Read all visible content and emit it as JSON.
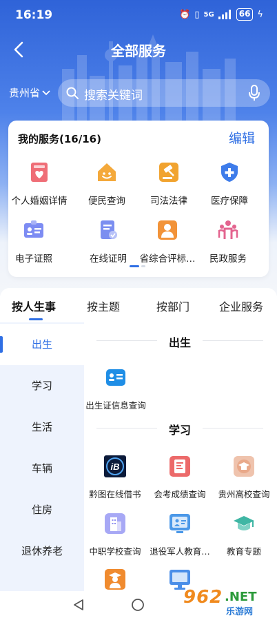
{
  "status_bar": {
    "time": "16:19",
    "network": "5G",
    "battery": "66"
  },
  "header": {
    "title": "全部服务"
  },
  "location": {
    "province": "贵州省"
  },
  "search": {
    "placeholder": "搜索关键词"
  },
  "my_services": {
    "title": "我的服务(16/16)",
    "edit_label": "编辑",
    "items": [
      {
        "label": "个人婚姻详情",
        "icon": "marriage-certificate-icon",
        "color": "#ef6e77"
      },
      {
        "label": "便民查询",
        "icon": "smile-house-icon",
        "color": "#f4a93b"
      },
      {
        "label": "司法法律",
        "icon": "gavel-icon",
        "color": "#f1a32f"
      },
      {
        "label": "医疗保障",
        "icon": "medical-shield-icon",
        "color": "#3e7cea"
      },
      {
        "label": "电子证照",
        "icon": "id-card-icon",
        "color": "#6f7ff0"
      },
      {
        "label": "在线证明",
        "icon": "document-check-icon",
        "color": "#6f86ea"
      },
      {
        "label": "省综合评标…",
        "icon": "person-badge-icon",
        "color": "#f29339"
      },
      {
        "label": "民政服务",
        "icon": "family-icon",
        "color": "#e3648f"
      }
    ]
  },
  "tabs": [
    {
      "label": "按人生事",
      "active": true
    },
    {
      "label": "按主题",
      "active": false
    },
    {
      "label": "按部门",
      "active": false
    },
    {
      "label": "企业服务",
      "active": false
    }
  ],
  "categories": [
    {
      "label": "出生",
      "active": true
    },
    {
      "label": "学习",
      "active": false
    },
    {
      "label": "生活",
      "active": false
    },
    {
      "label": "车辆",
      "active": false
    },
    {
      "label": "住房",
      "active": false
    },
    {
      "label": "退休养老",
      "active": false
    }
  ],
  "sections": [
    {
      "title": "出生",
      "items": [
        {
          "label": "出生证信息查询",
          "icon": "birth-certificate-icon",
          "color": "#1f8ee6"
        }
      ]
    },
    {
      "title": "学习",
      "items": [
        {
          "label": "黔图在线借书",
          "icon": "library-logo-icon",
          "color": "#0c1b3a"
        },
        {
          "label": "会考成绩查询",
          "icon": "exam-score-icon",
          "color": "#ec6a6a"
        },
        {
          "label": "贵州高校查询",
          "icon": "college-icon",
          "color": "#e9a98a"
        },
        {
          "label": "中职学校查询",
          "icon": "school-building-icon",
          "color": "#8e8df0"
        },
        {
          "label": "退役军人教育…",
          "icon": "veteran-education-icon",
          "color": "#4b98e8"
        },
        {
          "label": "教育专题",
          "icon": "graduation-cap-icon",
          "color": "#3fb6a4"
        },
        {
          "label": "",
          "icon": "graduate-person-icon",
          "color": "#f08b2f"
        },
        {
          "label": "",
          "icon": "computer-screen-icon",
          "color": "#4a8ee8"
        }
      ]
    }
  ],
  "watermark": {
    "number": "962",
    "domain": ".NET",
    "site": "乐游网"
  }
}
